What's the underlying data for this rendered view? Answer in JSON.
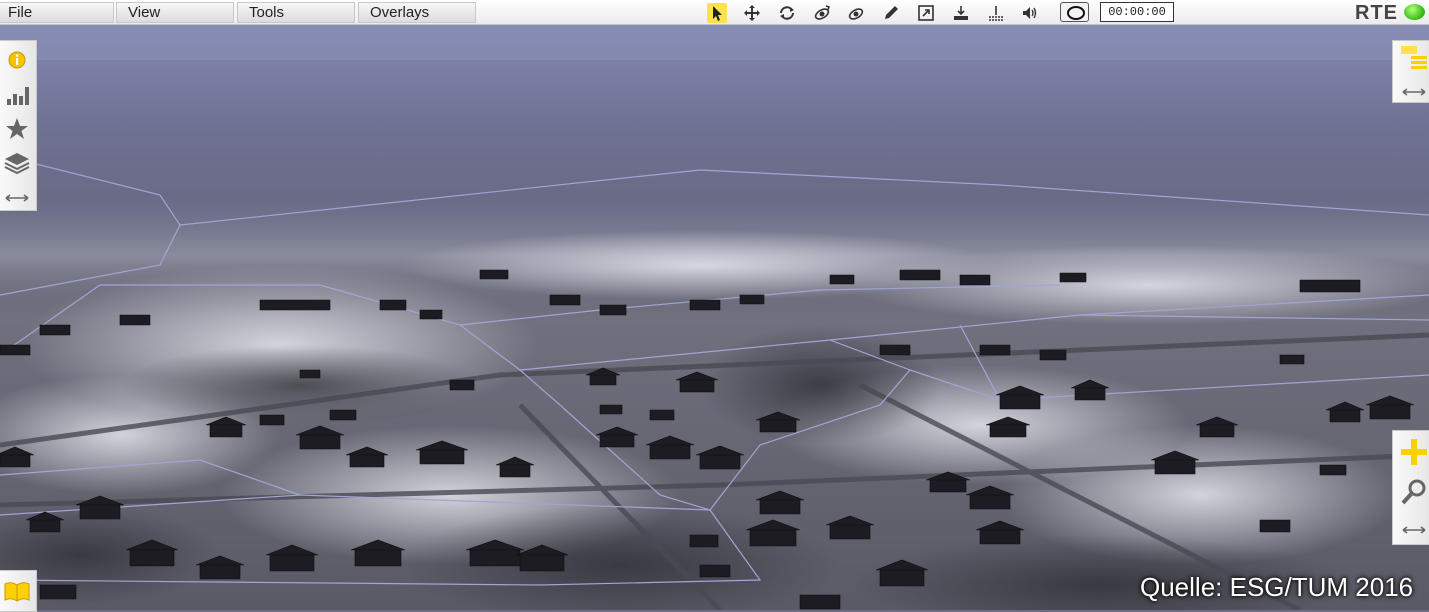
{
  "menubar": {
    "items": [
      "File",
      "View",
      "Tools",
      "Overlays"
    ]
  },
  "toolbar": {
    "tools": [
      "select-arrow-icon",
      "pan-move-icon",
      "rotate-icon",
      "fly-icon",
      "satellite-icon",
      "pencil-icon",
      "resize-icon",
      "elevation-icon",
      "ground-icon",
      "volume-icon"
    ],
    "active_tool": "select-arrow-icon",
    "record_icon": "record-icon",
    "timer": "00:00:00"
  },
  "app": {
    "brand": "RTE",
    "status_color": "#3fc21f"
  },
  "left_panel": {
    "buttons": [
      "info-icon",
      "chart-icon",
      "star-icon",
      "layers-icon",
      "resize-horizontal-icon"
    ]
  },
  "right_top_panel": {
    "buttons": [
      "list-icon",
      "resize-horizontal-icon"
    ]
  },
  "right_zoom_panel": {
    "buttons": [
      "zoom-in-plus-icon",
      "magnifier-icon",
      "resize-horizontal-icon"
    ]
  },
  "bottom_left": {
    "button": "book-icon"
  },
  "scene": {
    "sky_color": "#7e82a8",
    "ground_color": "#5d5d6f",
    "outline_color": "#9a9ccc"
  },
  "credit": "Quelle: ESG/TUM 2016"
}
